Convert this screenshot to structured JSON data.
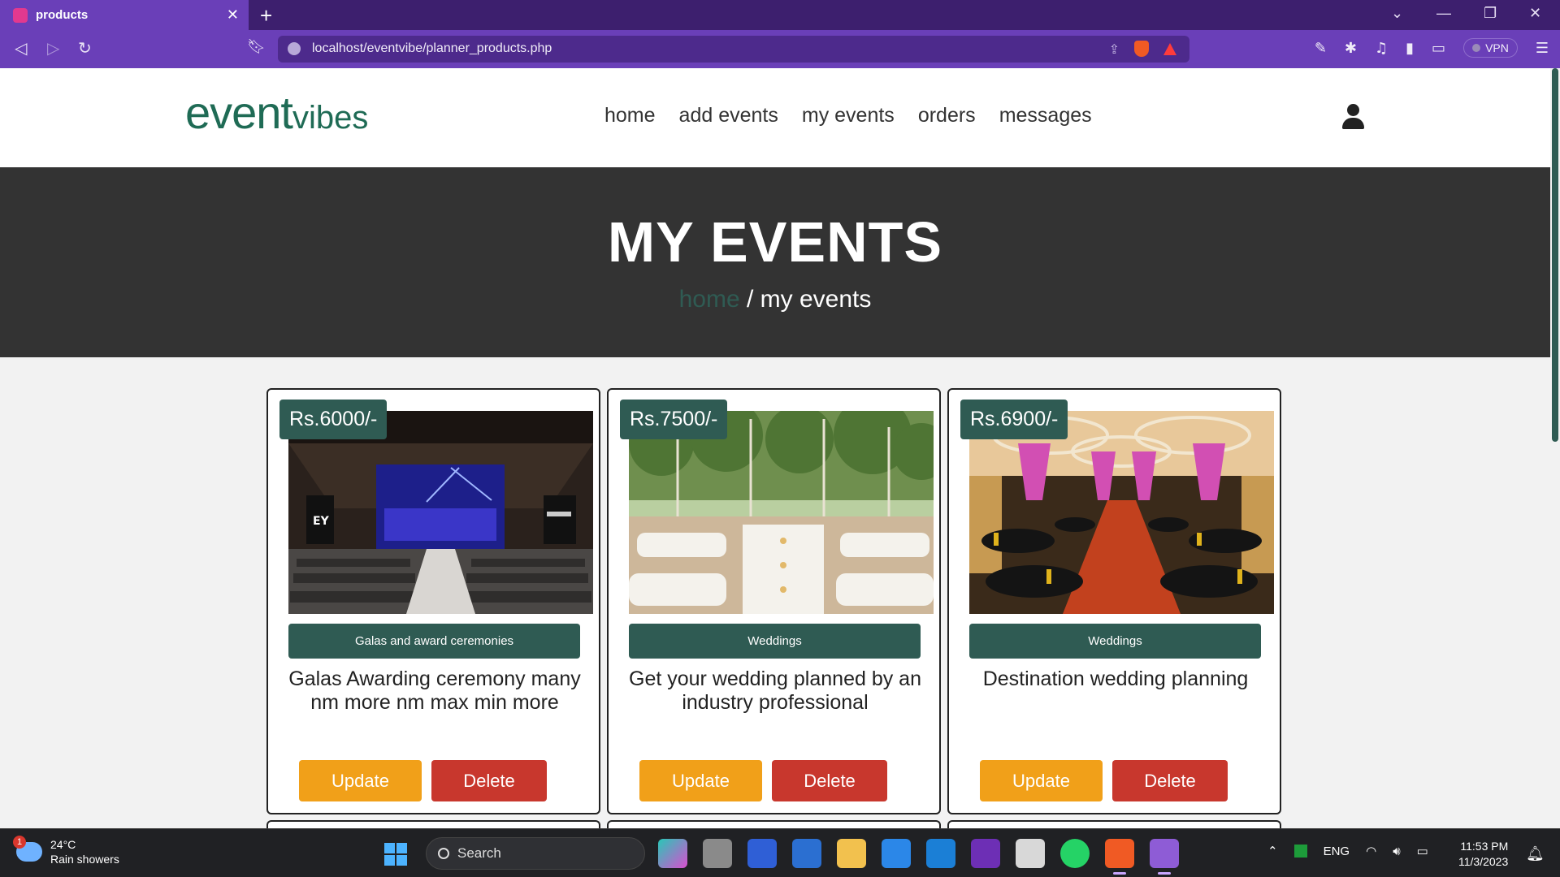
{
  "browser": {
    "tab_title": "products",
    "url": "localhost/eventvibe/planner_products.php",
    "vpn_label": "VPN",
    "accent": "#6a3fb8"
  },
  "site": {
    "logo_main": "event",
    "logo_sub": "vibes",
    "nav": [
      "home",
      "add events",
      "my events",
      "orders",
      "messages"
    ],
    "hero_title": "MY EVENTS",
    "crumb_home": "home",
    "crumb_current": " / my events",
    "colors": {
      "primary": "#2f5b53",
      "update": "#f1a019",
      "delete": "#c8372d",
      "hero_bg": "#333333"
    }
  },
  "products": [
    {
      "price": "Rs.6000/-",
      "category": "Galas and award ceremonies",
      "description": "Galas Awarding ceremony many nm more nm max min more",
      "update_label": "Update",
      "delete_label": "Delete",
      "image": "auditorium-stage"
    },
    {
      "price": "Rs.7500/-",
      "category": "Weddings",
      "description": "Get your wedding planned by an industry professional",
      "update_label": "Update",
      "delete_label": "Delete",
      "image": "garden-wedding-tables"
    },
    {
      "price": "Rs.6900/-",
      "category": "Weddings",
      "description": "Destination wedding planning",
      "update_label": "Update",
      "delete_label": "Delete",
      "image": "banquet-hall-lights"
    }
  ],
  "taskbar": {
    "weather_badge": "1",
    "temperature": "24°C",
    "weather_desc": "Rain showers",
    "search_label": "Search",
    "language": "ENG",
    "time": "11:53 PM",
    "date": "11/3/2023"
  }
}
